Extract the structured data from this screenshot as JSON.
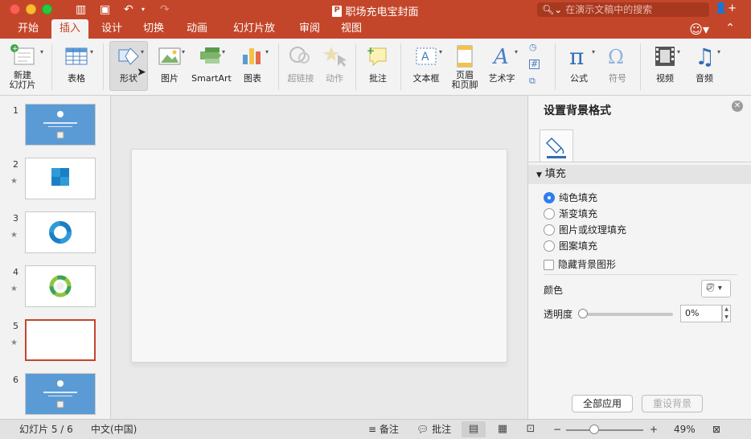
{
  "app": {
    "title": "职场充电宝封面",
    "search_placeholder": "在演示文稿中的搜索",
    "accent_color": "#c4462a"
  },
  "tabs": [
    {
      "label": "开始",
      "active": false
    },
    {
      "label": "插入",
      "active": true
    },
    {
      "label": "设计",
      "active": false
    },
    {
      "label": "切换",
      "active": false
    },
    {
      "label": "动画",
      "active": false
    },
    {
      "label": "幻灯片放映",
      "active": false
    },
    {
      "label": "审阅",
      "active": false
    },
    {
      "label": "视图",
      "active": false
    }
  ],
  "ribbon": {
    "new_slide": "新建\n幻灯片",
    "table": "表格",
    "shapes": "形状",
    "picture": "图片",
    "smartart": "SmartArt",
    "chart": "图表",
    "hyperlink": "超链接",
    "action": "动作",
    "comment": "批注",
    "textbox": "文本框",
    "header_footer": "页眉\n和页脚",
    "wordart": "艺术字",
    "equation": "公式",
    "symbol": "符号",
    "video": "视频",
    "audio": "音频"
  },
  "thumbnails": [
    {
      "num": "1",
      "star": false,
      "style": "blue",
      "selected": false
    },
    {
      "num": "2",
      "star": true,
      "style": "puzzle",
      "selected": false
    },
    {
      "num": "3",
      "star": true,
      "style": "ring",
      "selected": false
    },
    {
      "num": "4",
      "star": true,
      "style": "circle",
      "selected": false
    },
    {
      "num": "5",
      "star": true,
      "style": "blank",
      "selected": true
    },
    {
      "num": "6",
      "star": false,
      "style": "blue",
      "selected": false
    }
  ],
  "format_panel": {
    "title": "设置背景格式",
    "section": "填充",
    "fill_options": [
      {
        "label": "纯色填充",
        "checked": true
      },
      {
        "label": "渐变填充",
        "checked": false
      },
      {
        "label": "图片或纹理填充",
        "checked": false
      },
      {
        "label": "图案填充",
        "checked": false
      }
    ],
    "hide_bg_graphics": "隐藏背景图形",
    "color_label": "颜色",
    "transparency_label": "透明度",
    "transparency_value": "0%",
    "transparency_level": 0,
    "apply_all": "全部应用",
    "reset_bg": "重设背景"
  },
  "status": {
    "slide_info": "幻灯片 5 / 6",
    "language": "中文(中国)",
    "notes": "备注",
    "comments": "批注",
    "zoom": "49%",
    "zoom_minus": "−",
    "zoom_plus": "+"
  }
}
